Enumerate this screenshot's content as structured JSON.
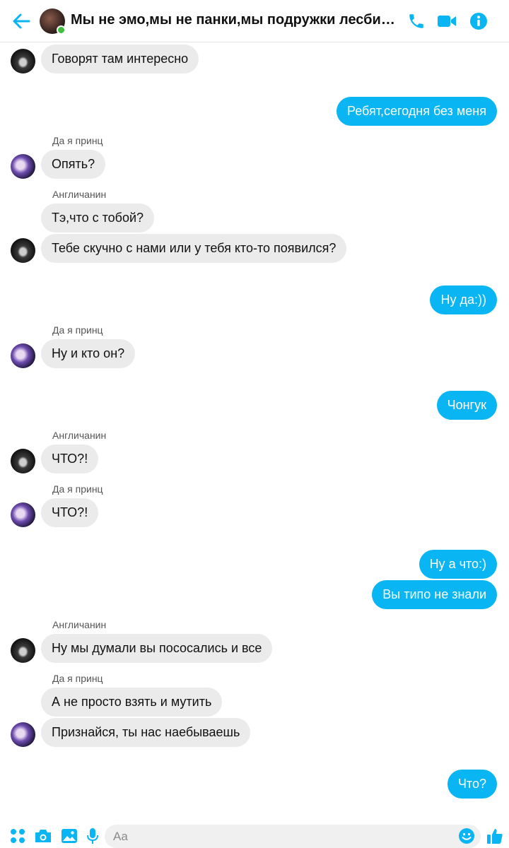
{
  "header": {
    "title": "Мы не эмо,мы не панки,мы подружки лесбиянк..."
  },
  "icons": {
    "back": "arrow-left-icon",
    "call": "phone-icon",
    "video": "video-camera-icon",
    "info": "info-icon",
    "apps": "grid-icon",
    "camera": "camera-icon",
    "gallery": "image-icon",
    "voice": "microphone-icon",
    "emoji": "smiley-icon",
    "like": "thumbs-up-icon"
  },
  "colors": {
    "accent": "#09b5f3",
    "incoming_bubble": "#ebebeb",
    "online": "#3fbf3f"
  },
  "messages": [
    {
      "text": "Говорят там интересно"
    },
    {
      "text": "Ребят,сегодня без меня"
    },
    {
      "sender": "Да я принц",
      "text": "Опять?"
    },
    {
      "sender": "Англичанин",
      "text": "Тэ,что с тобой?"
    },
    {
      "text": "Тебе скучно с нами или у тебя кто-то появился?"
    },
    {
      "text": "Ну да:))"
    },
    {
      "sender": "Да я принц",
      "text": "Ну и кто он?"
    },
    {
      "text": "Чонгук"
    },
    {
      "sender": "Англичанин",
      "text": "ЧТО?!"
    },
    {
      "sender": "Да я принц",
      "text": "ЧТО?!"
    },
    {
      "text": "Ну а что:)"
    },
    {
      "text": "Вы типо не знали"
    },
    {
      "sender": "Англичанин",
      "text": "Ну мы думали вы пососались и все"
    },
    {
      "sender": "Да я принц",
      "text": "А не просто взять и мутить"
    },
    {
      "text": "Признайся, ты нас наебываешь"
    },
    {
      "text": "Что?"
    }
  ],
  "composer": {
    "placeholder": "Aa"
  }
}
